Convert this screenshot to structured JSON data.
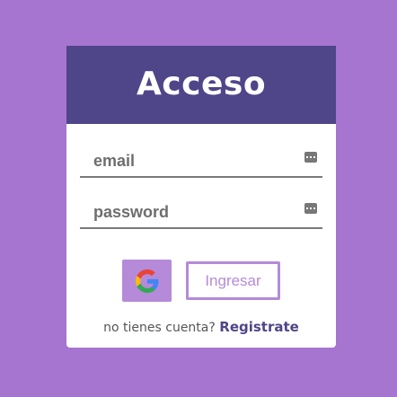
{
  "login_card": {
    "title": "Acceso",
    "email_placeholder": "email",
    "password_placeholder": "password",
    "login_label": "Ingresar",
    "no_account_text": "no tienes cuenta?",
    "register_label": "Registrate"
  },
  "icons": {
    "google_button": "google-icon",
    "email_field": "keyboard-icon",
    "password_field": "keyboard-icon"
  },
  "colors": {
    "background": "#a575d0",
    "header": "#4f4589",
    "accent": "#b48ad9",
    "register_link": "#4f4589"
  }
}
